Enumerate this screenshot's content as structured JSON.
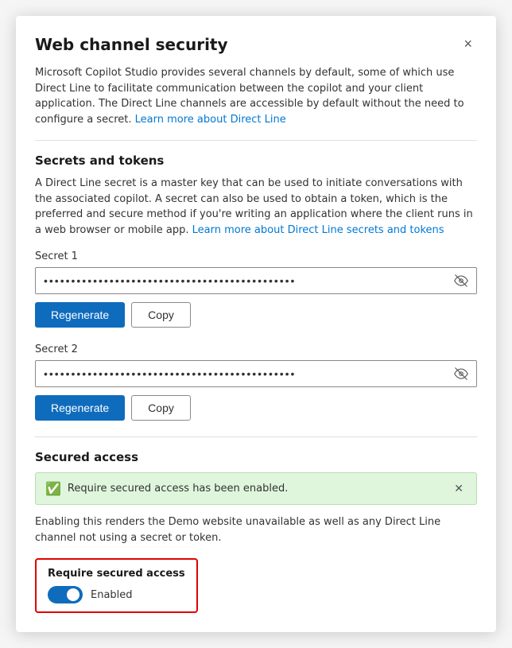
{
  "dialog": {
    "title": "Web channel security",
    "close_label": "×"
  },
  "intro": {
    "text": "Microsoft Copilot Studio provides several channels by default, some of which use Direct Line to facilitate communication between the copilot and your client application. The Direct Line channels are accessible by default without the need to configure a secret.",
    "link_text": "Learn more about Direct Line",
    "link_href": "#"
  },
  "secrets_section": {
    "title": "Secrets and tokens",
    "description": "A Direct Line secret is a master key that can be used to initiate conversations with the associated copilot. A secret can also be used to obtain a token, which is the preferred and secure method if you're writing an application where the client runs in a web browser or mobile app.",
    "link_text": "Learn more about Direct Line secrets and tokens",
    "link_href": "#"
  },
  "secret1": {
    "label": "Secret 1",
    "value": "••••••••••••••••••••••••••••••••••••••••••••••",
    "regenerate_label": "Regenerate",
    "copy_label": "Copy",
    "show_label": "Show secret"
  },
  "secret2": {
    "label": "Secret 2",
    "value": "••••••••••••••••••••••••••••••••••••••••••••••",
    "regenerate_label": "Regenerate",
    "copy_label": "Copy",
    "show_label": "Show secret"
  },
  "secured_access": {
    "title": "Secured access",
    "banner_text": "Require secured access has been enabled.",
    "description": "Enabling this renders the Demo website unavailable as well as any Direct Line channel not using a secret or token.",
    "toggle_label": "Require secured access",
    "toggle_status": "Enabled",
    "toggle_on": true
  }
}
